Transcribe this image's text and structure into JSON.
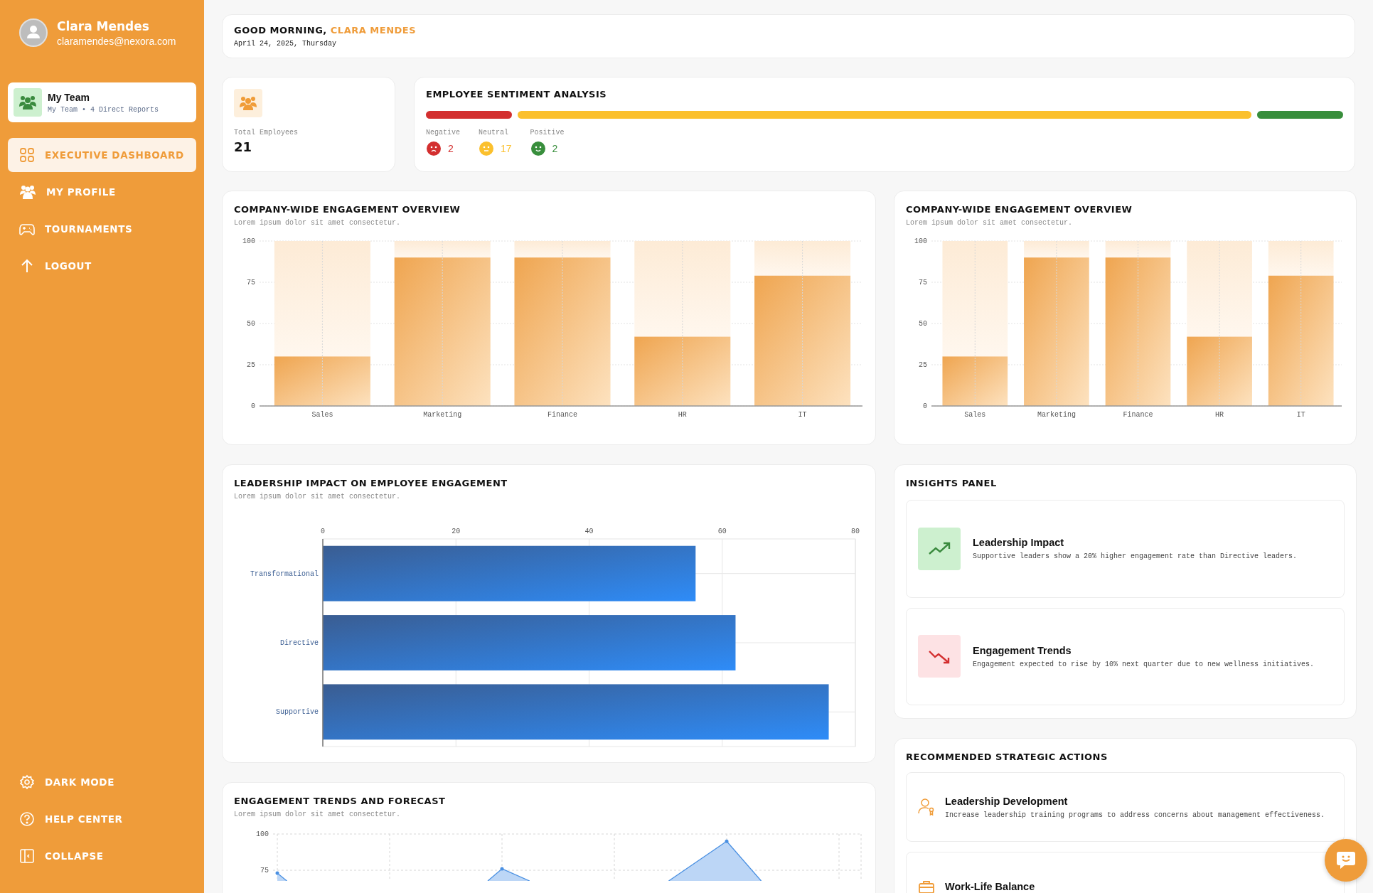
{
  "sidebar": {
    "user": {
      "name": "Clara Mendes",
      "email": "claramendes@nexora.com"
    },
    "team_card": {
      "title": "My Team",
      "subtitle": "My Team • 4 Direct Reports"
    },
    "nav_items": [
      {
        "label": "EXECUTIVE DASHBOARD",
        "selected": true
      },
      {
        "label": "MY PROFILE",
        "selected": false
      },
      {
        "label": "TOURNAMENTS",
        "selected": false
      },
      {
        "label": "LOGOUT",
        "selected": false
      }
    ],
    "footer_items": [
      {
        "label": "DARK MODE"
      },
      {
        "label": "HELP CENTER"
      },
      {
        "label": "COLLAPSE"
      }
    ]
  },
  "header": {
    "greeting": "GOOD MORNING,",
    "name": "CLARA MENDES",
    "date": "April 24, 2025, Thursday"
  },
  "total_employees": {
    "label": "Total Employees",
    "value": "21"
  },
  "sentiment": {
    "title": "EMPLOYEE SENTIMENT ANALYSIS",
    "segments": [
      {
        "kind": "negative",
        "label": "Negative",
        "count": "2",
        "color": "#d32f2f"
      },
      {
        "kind": "neutral",
        "label": "Neutral",
        "count": "17",
        "color": "#fbc02d"
      },
      {
        "kind": "positive",
        "label": "Positive",
        "count": "2",
        "color": "#388e3c"
      }
    ]
  },
  "engagement_overviews": [
    {
      "title": "COMPANY-WIDE ENGAGEMENT OVERVIEW",
      "subtitle": "Lorem ipsum dolor sit amet consectetur.",
      "chart_data": {
        "type": "bar",
        "categories": [
          "Sales",
          "Marketing",
          "Finance",
          "HR",
          "IT"
        ],
        "series": [
          {
            "color": "#efa550",
            "values": [
              30,
              90,
              90,
              42,
              79
            ]
          },
          {
            "color": "#fdebd6",
            "values": [
              70,
              10,
              10,
              58,
              21
            ]
          }
        ],
        "stacked": true,
        "grid": true,
        "ylim": [
          0,
          100
        ],
        "yticks": [
          0,
          25,
          50,
          75,
          100
        ]
      }
    },
    {
      "title": "COMPANY-WIDE ENGAGEMENT OVERVIEW",
      "subtitle": "Lorem ipsum dolor sit amet consectetur.",
      "chart_data": {
        "type": "bar",
        "categories": [
          "Sales",
          "Marketing",
          "Finance",
          "HR",
          "IT"
        ],
        "series": [
          {
            "color": "#efa550",
            "values": [
              30,
              90,
              90,
              42,
              79
            ]
          },
          {
            "color": "#fdebd6",
            "values": [
              70,
              10,
              10,
              58,
              21
            ]
          }
        ],
        "stacked": true,
        "grid": true,
        "ylim": [
          0,
          100
        ],
        "yticks": [
          0,
          25,
          50,
          75,
          100
        ]
      }
    }
  ],
  "leadership": {
    "title": "LEADERSHIP IMPACT ON EMPLOYEE ENGAGEMENT",
    "subtitle": "Lorem ipsum dolor sit amet consectetur.",
    "chart_data": {
      "type": "bar",
      "orientation": "horizontal",
      "categories": [
        "Transformational",
        "Directive",
        "Supportive"
      ],
      "values": [
        56,
        62,
        76
      ],
      "grid": true,
      "xlim": [
        0,
        80
      ],
      "xticks": [
        0,
        20,
        40,
        60,
        80
      ]
    }
  },
  "trends": {
    "title": "ENGAGEMENT TRENDS AND FORECAST",
    "subtitle": "Lorem ipsum dolor sit amet consectetur.",
    "axis_labels": [
      "100",
      "75"
    ]
  },
  "insights": {
    "title": "INSIGHTS PANEL",
    "items": [
      {
        "kind": "up",
        "title": "Leadership Impact",
        "text": "Supportive leaders show a 20% higher engagement rate than Directive leaders."
      },
      {
        "kind": "down",
        "title": "Engagement Trends",
        "text": "Engagement expected to rise by 10% next quarter due to new wellness initiatives."
      }
    ]
  },
  "actions": {
    "title": "RECOMMENDED STRATEGIC ACTIONS",
    "items": [
      {
        "kind": "leadership",
        "title": "Leadership Development",
        "text": "Increase leadership training programs to address concerns about management effectiveness."
      },
      {
        "kind": "balance",
        "title": "Work-Life Balance"
      }
    ]
  }
}
